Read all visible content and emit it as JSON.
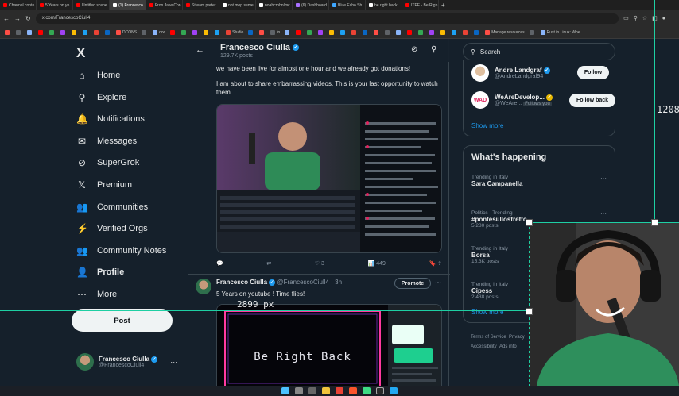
{
  "browser": {
    "tabs": [
      {
        "label": "Channel conte",
        "color": "#ff0000"
      },
      {
        "label": "5 Years on yo",
        "color": "#ff0000"
      },
      {
        "label": "Untitled scene",
        "color": "#ff0000"
      },
      {
        "label": "(1) Francesco",
        "color": "#ffffff"
      },
      {
        "label": "Fron JawaCon",
        "color": "#ff0000"
      },
      {
        "label": "Stream parter",
        "color": "#ff0000"
      },
      {
        "label": "not mop serve",
        "color": "#ffffff"
      },
      {
        "label": "noahcrohn/mc",
        "color": "#ffffff"
      },
      {
        "label": "(6) Dashboard",
        "color": "#a970ff"
      },
      {
        "label": "Blue Echo Sh",
        "color": "#3ea6ff"
      },
      {
        "label": "be right back",
        "color": "#ffffff"
      },
      {
        "label": "ITEE - Be Righ",
        "color": "#ff0000"
      }
    ],
    "active_tab": 3,
    "url": "x.com/FrancescoCiull4",
    "bookmarks": [
      "",
      "",
      "",
      "",
      "",
      "",
      "",
      "",
      "",
      "",
      "DCONS",
      "",
      "doc",
      "",
      "",
      "",
      "",
      "",
      "Studio",
      "",
      "",
      "in",
      "",
      "",
      "",
      "",
      "",
      "",
      "",
      "",
      "",
      "",
      "",
      "",
      "",
      "",
      "",
      "",
      "",
      "",
      "Manage resources",
      "",
      "Rust in Linux: Whe..."
    ]
  },
  "sidebar": {
    "logo": "X",
    "items": [
      {
        "label": "Home",
        "icon": "home-icon",
        "glyph": "⌂"
      },
      {
        "label": "Explore",
        "icon": "search-icon",
        "glyph": "⚲"
      },
      {
        "label": "Notifications",
        "icon": "bell-icon",
        "glyph": "🔔"
      },
      {
        "label": "Messages",
        "icon": "envelope-icon",
        "glyph": "✉"
      },
      {
        "label": "SuperGrok",
        "icon": "grok-icon",
        "glyph": "⊘"
      },
      {
        "label": "Premium",
        "icon": "x-logo-icon",
        "glyph": "𝕏"
      },
      {
        "label": "Communities",
        "icon": "people-icon",
        "glyph": "👥"
      },
      {
        "label": "Verified Orgs",
        "icon": "lightning-icon",
        "glyph": "⚡"
      },
      {
        "label": "Community Notes",
        "icon": "notes-icon",
        "glyph": "👥"
      },
      {
        "label": "Profile",
        "icon": "person-icon",
        "glyph": "👤"
      },
      {
        "label": "More",
        "icon": "more-circle-icon",
        "glyph": "⋯"
      }
    ],
    "post_label": "Post",
    "account": {
      "name": "Francesco Ciulla",
      "handle": "@FrancescoCiull4"
    }
  },
  "header": {
    "name": "Francesco Ciulla",
    "posts": "129.7K posts"
  },
  "tweet1": {
    "text1": "we have been live for almost one hour and we already got donations!",
    "text2": "I am about to share embarrassing videos. This is your last opportunity to watch them.",
    "actions": {
      "reply": "",
      "repost": "",
      "like": "3",
      "views": "449"
    }
  },
  "tweet2": {
    "name": "Francesco Ciulla",
    "handle": "@FrancescoCiull4",
    "time": "3h",
    "promote": "Promote",
    "text": "5 Years on youtube ! Time flies!",
    "media_text": "Be Right Back"
  },
  "right": {
    "search_placeholder": "Search",
    "suggestions": [
      {
        "name": "Andre Landgraf",
        "handle": "@AndreLandgraf94",
        "button": "Follow",
        "badge": ""
      },
      {
        "name": "WeAreDevelop...",
        "handle": "@WeAre...",
        "button": "Follow back",
        "badge": "Follows you"
      }
    ],
    "show_more": "Show more",
    "happening_title": "What's happening",
    "trends": [
      {
        "context": "Trending in Italy",
        "title": "Sara Campanella",
        "count": ""
      },
      {
        "context": "Politics · Trending",
        "title": "#pontesullostretto",
        "count": "5,280 posts"
      },
      {
        "context": "Trending in Italy",
        "title": "Borsa",
        "count": "15.3K posts"
      },
      {
        "context": "Trending in Italy",
        "title": "Cipess",
        "count": "2,438 posts"
      }
    ],
    "trends_show_more": "Show more",
    "footer1": "Terms of Service",
    "footer2": "Privacy",
    "footer3": "Accessibility",
    "footer4": "Ads info"
  },
  "overlay": {
    "measure_text": "2899 px",
    "measure_text2": "1208",
    "guide_color": "#1ecfa3"
  },
  "colors": {
    "bg": "#15202b",
    "accent": "#1d9bf0",
    "border": "#38444d",
    "muted": "#8b98a5"
  }
}
